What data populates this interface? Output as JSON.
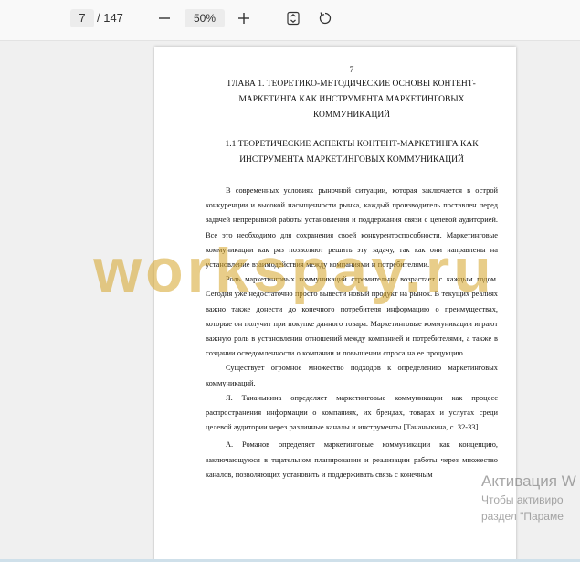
{
  "toolbar": {
    "current_page": "7",
    "total_pages": "/ 147",
    "zoom": "50%",
    "icons": {
      "zoom_out": "minus-icon",
      "zoom_in": "plus-icon",
      "fit": "fit-page-icon",
      "rotate": "rotate-icon"
    }
  },
  "document": {
    "page_number": "7",
    "chapter_title_lines": [
      "ГЛАВА 1. ТЕОРЕТИКО-МЕТОДИЧЕСКИЕ ОСНОВЫ КОНТЕНТ-",
      "МАРКЕТИНГА КАК ИНСТРУМЕНТА МАРКЕТИНГОВЫХ",
      "КОММУНИКАЦИЙ"
    ],
    "section_title_lines": [
      "1.1 ТЕОРЕТИЧЕСКИЕ АСПЕКТЫ КОНТЕНТ-МАРКЕТИНГА КАК",
      "ИНСТРУМЕНТА МАРКЕТИНГОВЫХ КОММУНИКАЦИЙ"
    ],
    "paragraphs": [
      "В современных условиях рыночной ситуации, которая заключается в острой конкуренции и высокой насыщенности рынка, каждый производитель поставлен перед задачей непрерывной работы установления и поддержания связи с целевой аудиторией. Все это необходимо для сохранения своей конкурентоспособности. Маркетинговые коммуникации как раз позволяют решить эту задачу, так как они направлены на установление взаимодействия между компаниями и потребителями.",
      "Роль маркетинговых коммуникаций стремительно возрастает с каждым годом. Сегодня уже недостаточно просто вывести новый продукт на рынок. В текущих реалиях важно также донести до конечного потребителя информацию о преимуществах, которые он получит при покупке данного товара. Маркетинговые коммуникации играют важную роль в установлении отношений между компанией и потребителями, а также в создании осведомленности о компании и повышении спроса на ее продукцию.",
      "Существует огромное множество подходов к определению маркетинговых коммуникаций.",
      "Я. Тананыкина определяет маркетинговые коммуникации как процесс распространения информации о компаниях, их брендах, товарах и услугах среди целевой аудитории через различные каналы и инструменты [Тананыкина, с. 32-33].",
      "А. Романов определяет маркетинговые коммуникации как концепцию, заключающуюся в тщательном планировании и реализации работы через множество каналов, позволяющих установить и поддерживать связь с конечным"
    ]
  },
  "watermark": "workspay.ru",
  "activation": {
    "title": "Активация W",
    "line1": "Чтобы активиро",
    "line2": "раздел \"Параме"
  }
}
